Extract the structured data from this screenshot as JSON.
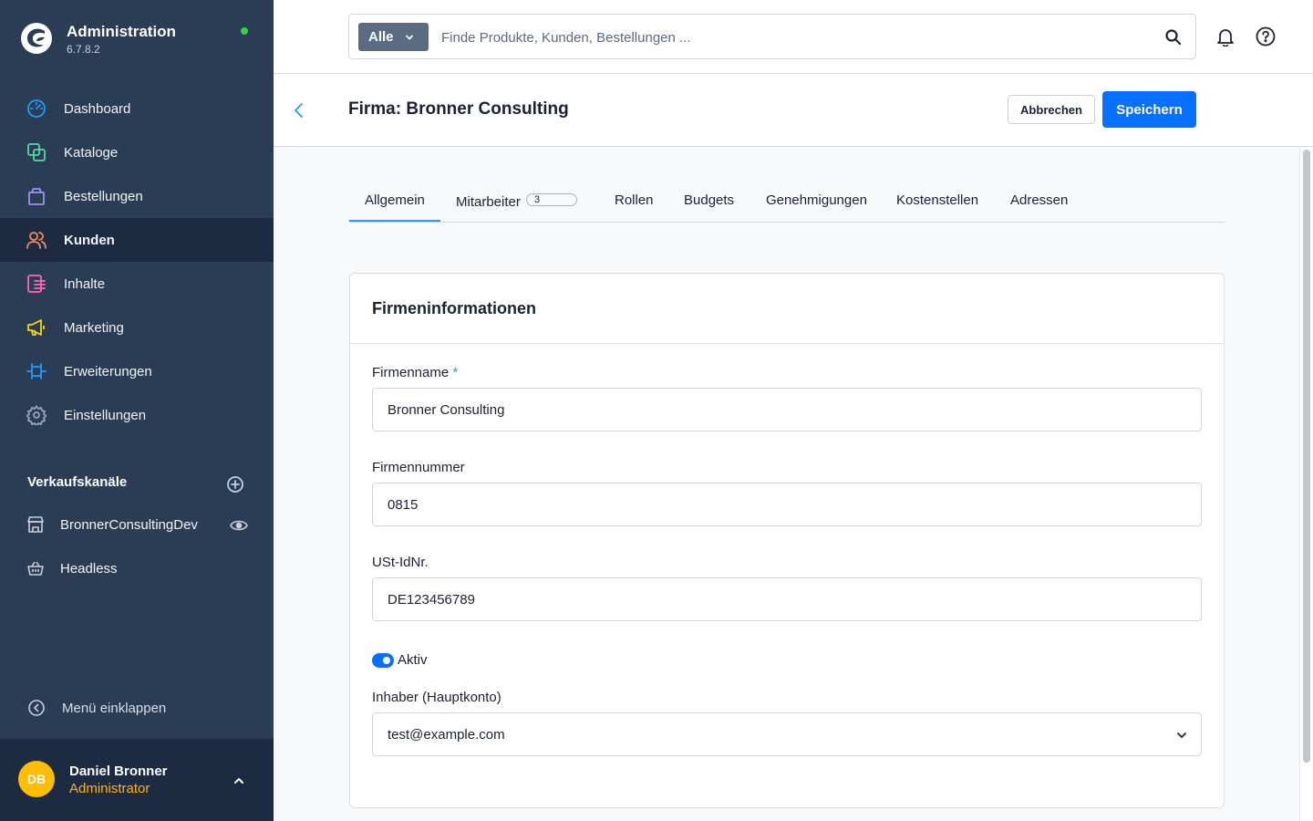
{
  "colors": {
    "sidebar_bg": "#2b3c55",
    "sidebar_active": "#1c2b42",
    "primary": "#0870ff",
    "accent_tab": "#189eff",
    "status_online": "#37d046",
    "avatar_bg": "#ffbd00",
    "user_role": "#ffb31a"
  },
  "brand": {
    "title": "Administration",
    "version": "6.7.8.2",
    "logo_icon": "shopware-logo"
  },
  "nav": {
    "items": [
      {
        "label": "Dashboard",
        "icon": "gauge-icon",
        "color": "#189eff"
      },
      {
        "label": "Kataloge",
        "icon": "products-icon",
        "color": "#57d9a3"
      },
      {
        "label": "Bestellungen",
        "icon": "shopping-bag-icon",
        "color": "#a092f0"
      },
      {
        "label": "Kunden",
        "icon": "users-icon",
        "color": "#f88962",
        "active": true
      },
      {
        "label": "Inhalte",
        "icon": "content-icon",
        "color": "#ff68b4"
      },
      {
        "label": "Marketing",
        "icon": "megaphone-icon",
        "color": "#ffd700"
      },
      {
        "label": "Erweiterungen",
        "icon": "plug-icon",
        "color": "#189eff"
      },
      {
        "label": "Einstellungen",
        "icon": "gear-icon",
        "color": "#9aa8b5"
      }
    ]
  },
  "sales_channels": {
    "title": "Verkaufskanäle",
    "items": [
      {
        "label": "BronnerConsultingDev",
        "icon": "storefront-icon"
      },
      {
        "label": "Headless",
        "icon": "basket-icon"
      }
    ]
  },
  "collapse_label": "Menü einklappen",
  "user": {
    "initials": "DB",
    "name": "Daniel Bronner",
    "role": "Administrator"
  },
  "search": {
    "type_label": "Alle",
    "placeholder": "Finde Produkte, Kunden, Bestellungen ..."
  },
  "page": {
    "title": "Firma: Bronner Consulting",
    "cancel_label": "Abbrechen",
    "save_label": "Speichern"
  },
  "tabs": [
    {
      "label": "Allgemein",
      "active": true
    },
    {
      "label": "Mitarbeiter",
      "badge": "3"
    },
    {
      "label": "Rollen"
    },
    {
      "label": "Budgets"
    },
    {
      "label": "Genehmigungen"
    },
    {
      "label": "Kostenstellen"
    },
    {
      "label": "Adressen"
    }
  ],
  "card": {
    "title": "Firmeninformationen",
    "company_name": {
      "label": "Firmenname",
      "required_mark": "*",
      "value": "Bronner Consulting"
    },
    "company_number": {
      "label": "Firmennummer",
      "value": "0815"
    },
    "vat_id": {
      "label": "USt-IdNr.",
      "value": "DE123456789"
    },
    "active": {
      "label": "Aktiv",
      "checked": true
    },
    "owner": {
      "label": "Inhaber (Hauptkonto)",
      "value": "test@example.com"
    }
  }
}
